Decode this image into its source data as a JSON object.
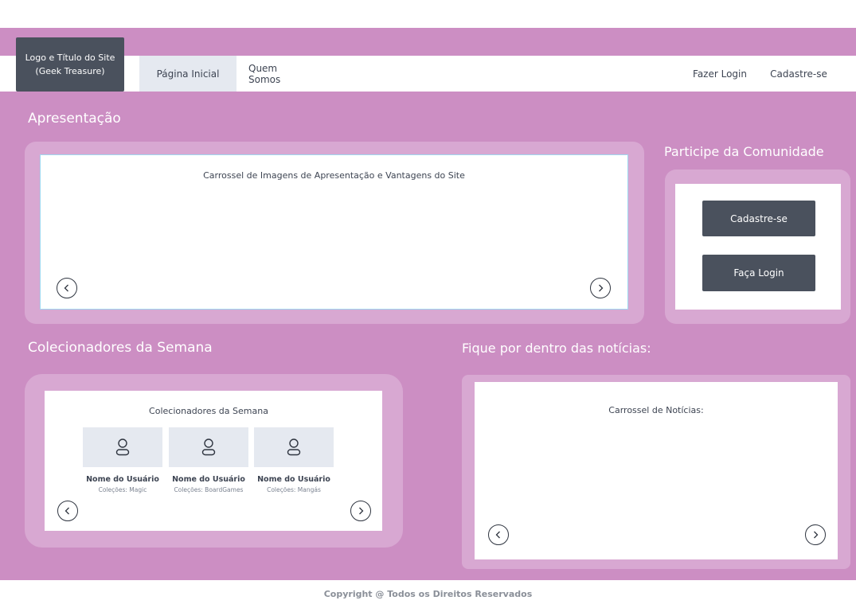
{
  "header": {
    "logo_line1": "Logo e Título do Site",
    "logo_line2": "(Geek Treasure)",
    "nav": {
      "home": "Página Inicial",
      "about": "Quem Somos",
      "login": "Fazer Login",
      "signup": "Cadastre-se"
    }
  },
  "presentation": {
    "title": "Apresentação",
    "carousel_text": "Carrossel de Imagens de Apresentação e Vantagens do Site"
  },
  "community": {
    "title": "Participe da Comunidade",
    "signup_button": "Cadastre-se",
    "login_button": "Faça Login"
  },
  "collectors": {
    "section_title": "Colecionadores da Semana",
    "box_title": "Colecionadores da Semana",
    "users": [
      {
        "name": "Nome do Usuário",
        "collections": "Coleções: Magic"
      },
      {
        "name": "Nome do Usuário",
        "collections": "Coleções: BoardGames"
      },
      {
        "name": "Nome do Usuário",
        "collections": "Coleções: Mangás"
      }
    ]
  },
  "news": {
    "section_title": "Fique por dentro das notícias:",
    "carousel_text": "Carrossel de Notícias:"
  },
  "footer": {
    "copyright": "Copyright @ Todos os Direitos Reservados"
  },
  "colors": {
    "accent": "#cc8ec3",
    "panel": "#d8a8d2",
    "dark": "#4a515d",
    "nav_active": "#e5e9f0"
  },
  "icons": [
    "chevron-left-icon",
    "chevron-right-icon",
    "user-icon"
  ]
}
